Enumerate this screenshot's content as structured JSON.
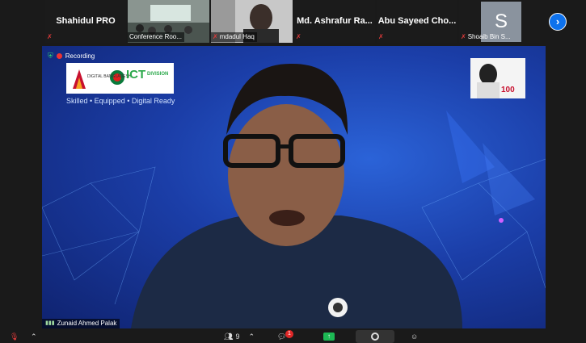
{
  "participants": [
    {
      "name": "Shahidul PRO",
      "label": ""
    },
    {
      "name": "",
      "label": "Conference Roo..."
    },
    {
      "name": "",
      "label": "mdadul Haq"
    },
    {
      "name": "Md. Ashrafur Ra...",
      "label": ""
    },
    {
      "name": "Abu Sayeed Cho...",
      "label": ""
    },
    {
      "name": "",
      "label": "Shoaib Bin S...",
      "avatar_letter": "S"
    }
  ],
  "main_video": {
    "recording_label": "Recording",
    "logo_ict": "ICT",
    "logo_ict_sub": "DIVISION",
    "logo_db": "DIGITAL BANGLADESH",
    "tagline": "Skilled • Equipped • Digital Ready",
    "speaker_name": "Zunaid Ahmed Palak"
  },
  "toolbar": {
    "participants_count": "9",
    "chat_badge": "1"
  },
  "colors": {
    "accent": "#0e72ed",
    "mic_off": "#e23b3b",
    "share_green": "#1db954"
  }
}
